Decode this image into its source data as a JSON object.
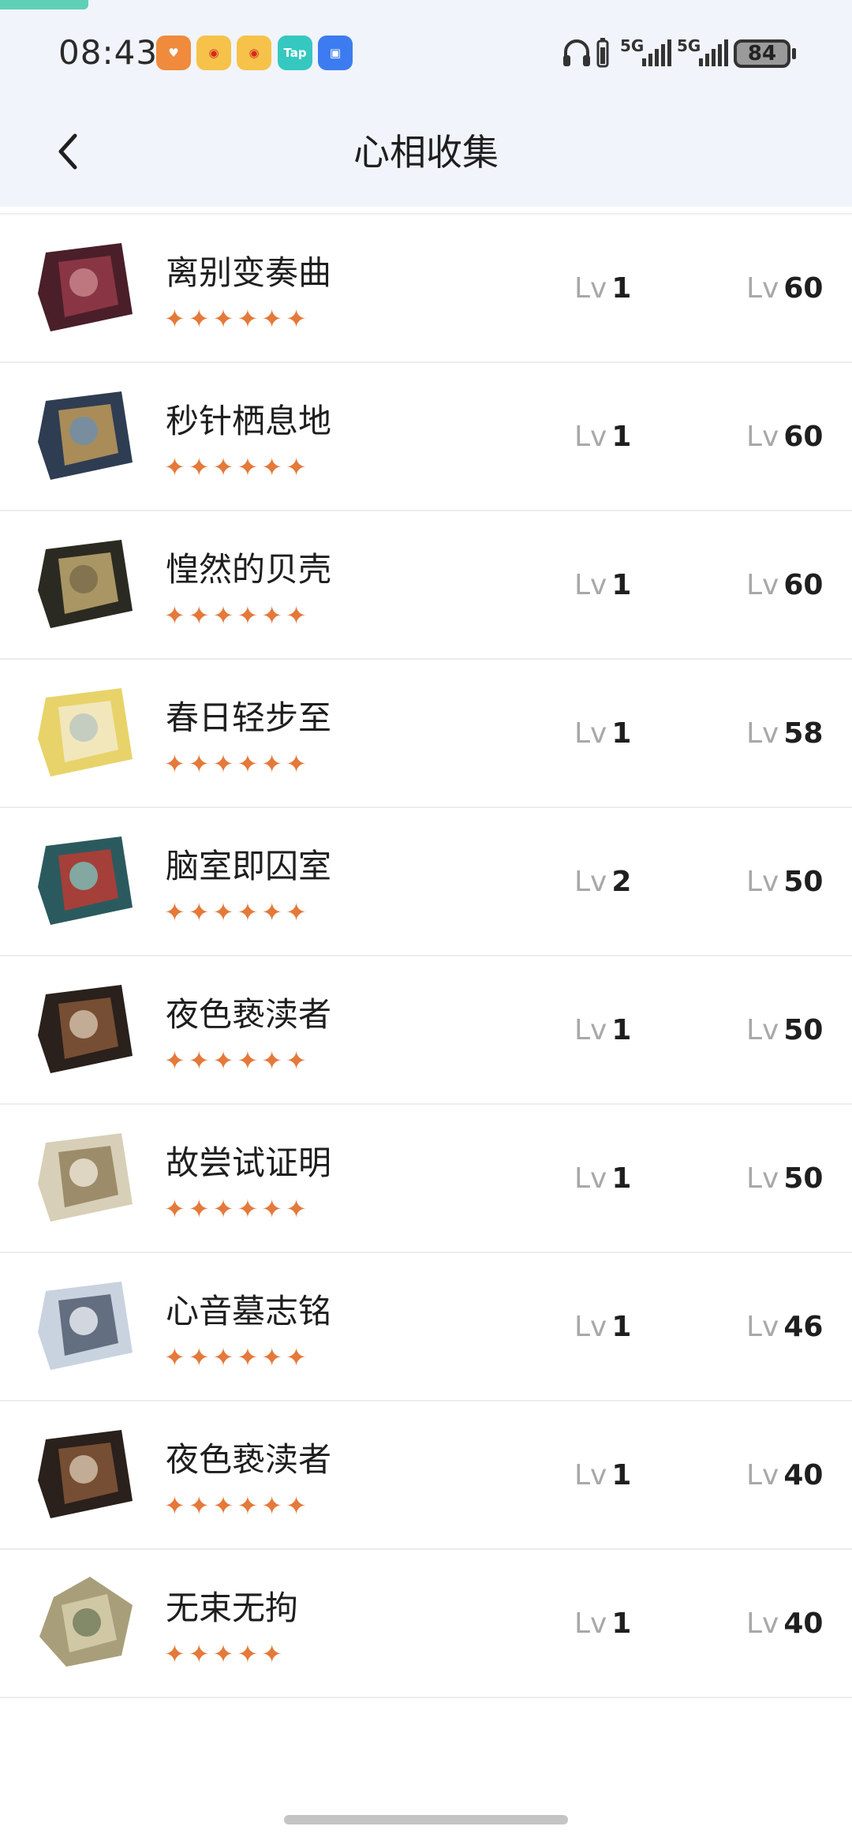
{
  "status_bar": {
    "time": "08:43",
    "apps": [
      {
        "icon": "health-app-icon",
        "color": "#f08a3c",
        "label": "♥"
      },
      {
        "icon": "weibo-icon",
        "color": "#f6c24a",
        "label": "◉"
      },
      {
        "icon": "weibo-icon",
        "color": "#f6c24a",
        "label": "◉"
      },
      {
        "icon": "taptap-icon",
        "color": "#35c8c0",
        "label": "Tap"
      },
      {
        "icon": "app-market-icon",
        "color": "#3d7cf0",
        "label": "▣"
      }
    ],
    "network_1": "5G",
    "network_2": "5G",
    "battery": "84"
  },
  "nav": {
    "title": "心相收集",
    "back_icon": "chevron-left-icon"
  },
  "items": [
    {
      "name": "离别变奏曲",
      "stars": "✦✦✦✦✦✦",
      "lv_prefix": "Lv",
      "lv_current": "1",
      "lv_max": "60",
      "thumb_colors": [
        "#4a1f2a",
        "#9a3b4a",
        "#c98a8f"
      ]
    },
    {
      "name": "秒针栖息地",
      "stars": "✦✦✦✦✦✦",
      "lv_prefix": "Lv",
      "lv_current": "1",
      "lv_max": "60",
      "thumb_colors": [
        "#2e3d52",
        "#c8a05a",
        "#6b8fb0"
      ]
    },
    {
      "name": "惶然的贝壳",
      "stars": "✦✦✦✦✦✦",
      "lv_prefix": "Lv",
      "lv_current": "1",
      "lv_max": "60",
      "thumb_colors": [
        "#2b2a22",
        "#c9b276",
        "#7a6a4a"
      ]
    },
    {
      "name": "春日轻步至",
      "stars": "✦✦✦✦✦✦",
      "lv_prefix": "Lv",
      "lv_current": "1",
      "lv_max": "58",
      "thumb_colors": [
        "#e8d36a",
        "#f3ecd0",
        "#b9c7c0"
      ]
    },
    {
      "name": "脑室即囚室",
      "stars": "✦✦✦✦✦✦",
      "lv_prefix": "Lv",
      "lv_current": "2",
      "lv_max": "50",
      "thumb_colors": [
        "#2b5a5e",
        "#c4382f",
        "#7bc2bc"
      ]
    },
    {
      "name": "夜色亵渎者",
      "stars": "✦✦✦✦✦✦",
      "lv_prefix": "Lv",
      "lv_current": "1",
      "lv_max": "50",
      "thumb_colors": [
        "#2a201c",
        "#8a5a3a",
        "#d6c4ae"
      ]
    },
    {
      "name": "故尝试证明",
      "stars": "✦✦✦✦✦✦",
      "lv_prefix": "Lv",
      "lv_current": "1",
      "lv_max": "50",
      "thumb_colors": [
        "#d8cfb8",
        "#8d7a55",
        "#efe8d8"
      ]
    },
    {
      "name": "心音墓志铭",
      "stars": "✦✦✦✦✦✦",
      "lv_prefix": "Lv",
      "lv_current": "1",
      "lv_max": "46",
      "thumb_colors": [
        "#c9d3e0",
        "#4a5568",
        "#eef1f6"
      ]
    },
    {
      "name": "夜色亵渎者",
      "stars": "✦✦✦✦✦✦",
      "lv_prefix": "Lv",
      "lv_current": "1",
      "lv_max": "40",
      "thumb_colors": [
        "#2a201c",
        "#8a5a3a",
        "#d6c4ae"
      ]
    },
    {
      "name": "无束无拘",
      "stars": "✦✦✦✦✦",
      "lv_prefix": "Lv",
      "lv_current": "1",
      "lv_max": "40",
      "thumb_colors": [
        "#a89f7a",
        "#d9d2b0",
        "#6f7a5a"
      ]
    }
  ]
}
